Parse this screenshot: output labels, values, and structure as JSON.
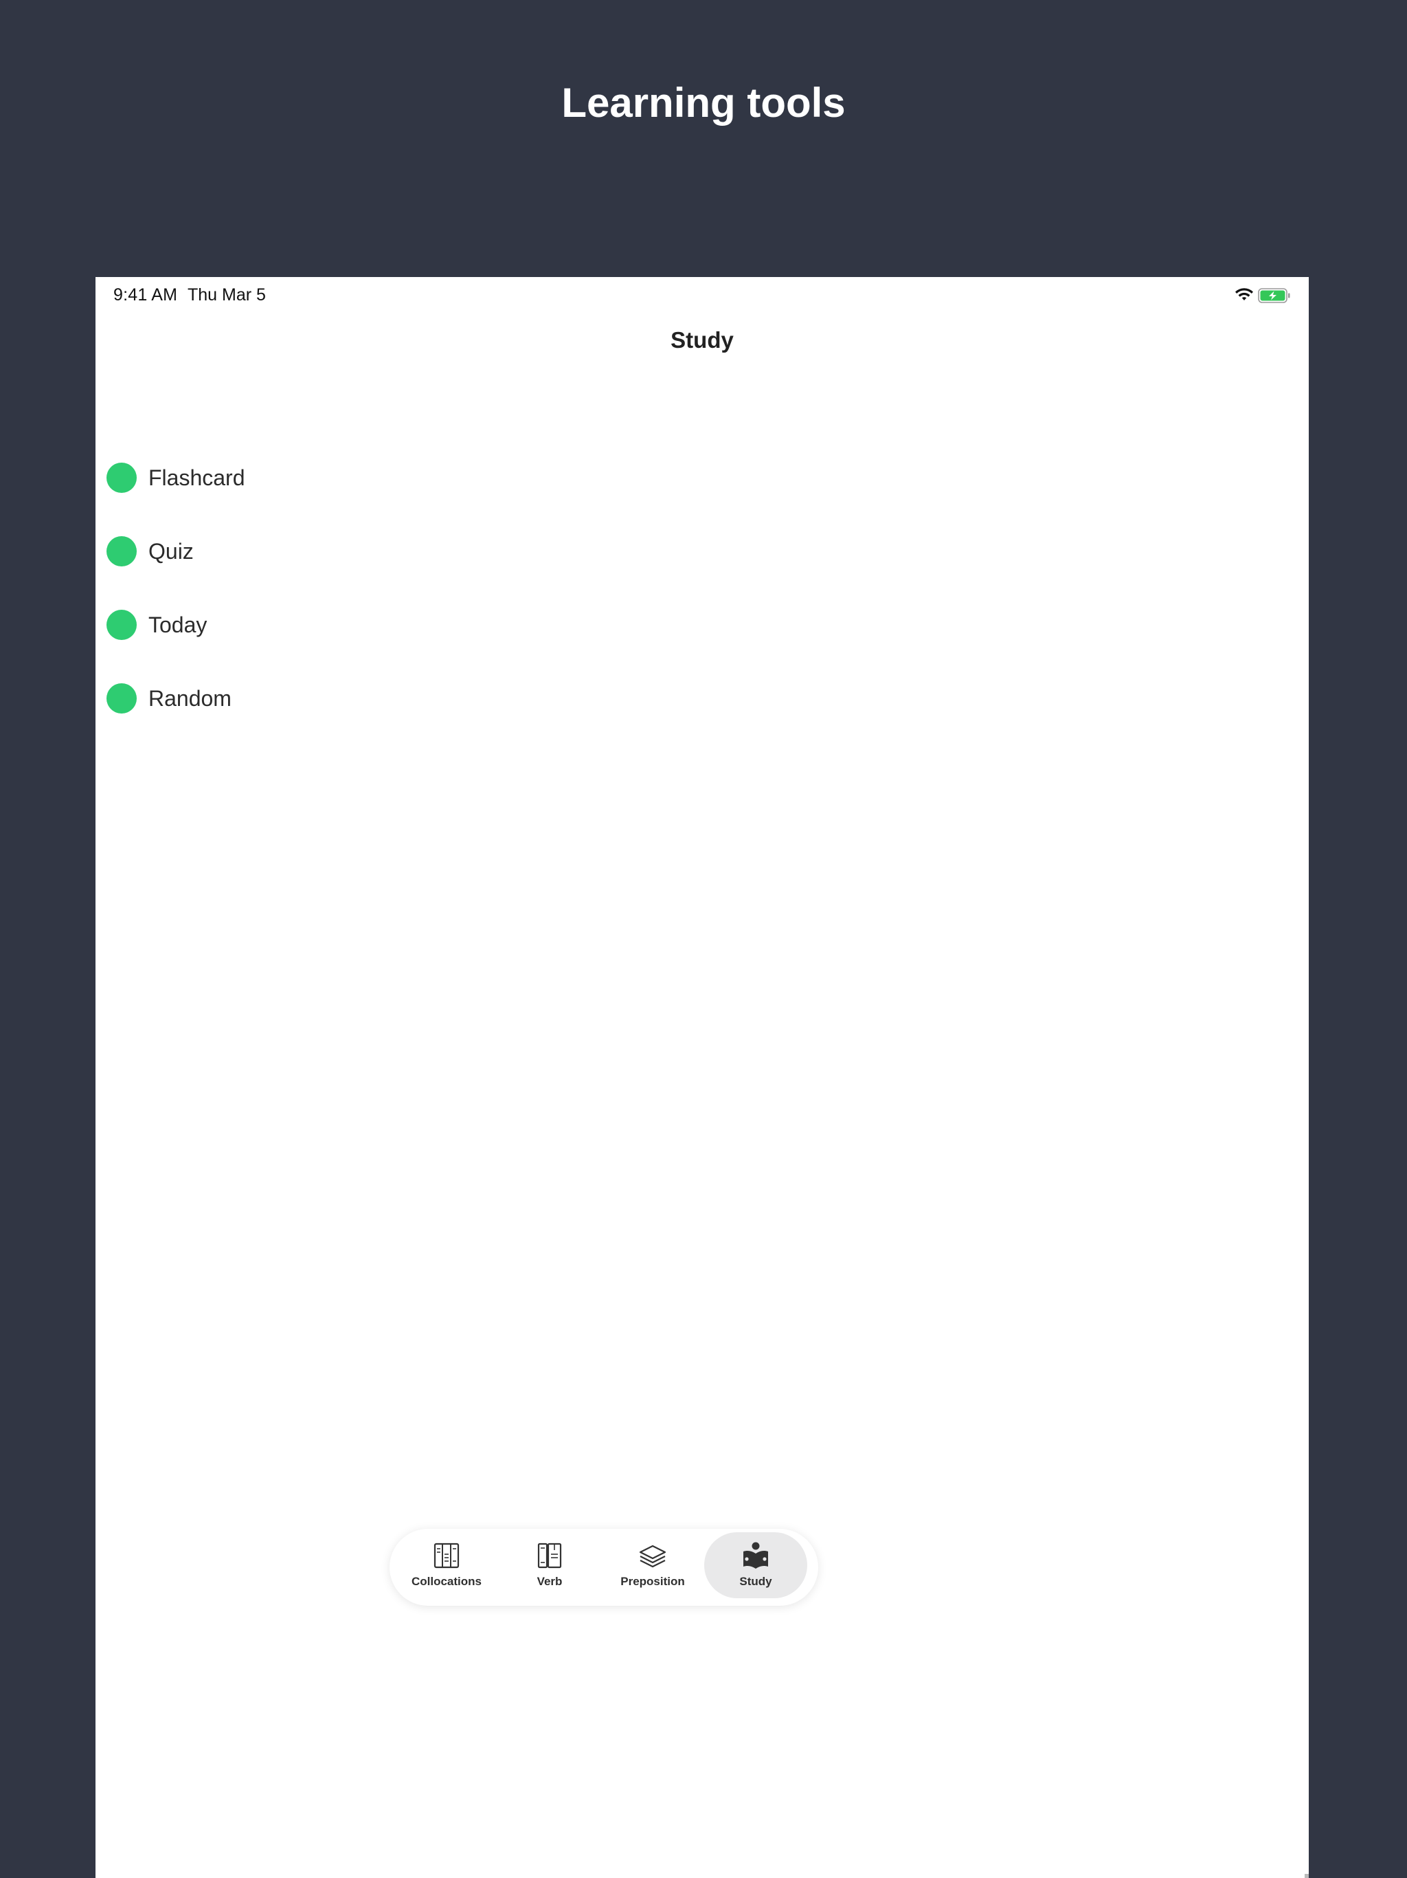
{
  "promo": {
    "title": "Learning tools"
  },
  "status_bar": {
    "time": "9:41 AM",
    "date": "Thu Mar 5",
    "wifi_icon": "wifi-icon",
    "battery_icon": "battery-charging-icon",
    "battery_color": "#34c759"
  },
  "nav": {
    "title": "Study"
  },
  "study_items": [
    {
      "label": "Flashcard",
      "icon": "green-dot-icon"
    },
    {
      "label": "Quiz",
      "icon": "green-dot-icon"
    },
    {
      "label": "Today",
      "icon": "green-dot-icon"
    },
    {
      "label": "Random",
      "icon": "green-dot-icon"
    }
  ],
  "tab_bar": {
    "tabs": [
      {
        "label": "Collocations",
        "icon": "book-columns-icon",
        "active": false
      },
      {
        "label": "Verb",
        "icon": "books-icon",
        "active": false
      },
      {
        "label": "Preposition",
        "icon": "layers-icon",
        "active": false
      },
      {
        "label": "Study",
        "icon": "reading-person-icon",
        "active": true
      }
    ]
  },
  "colors": {
    "background": "#313644",
    "accent_dot": "#2ecc71",
    "screen": "#ffffff",
    "active_tab_bg": "#e9e9ea"
  }
}
